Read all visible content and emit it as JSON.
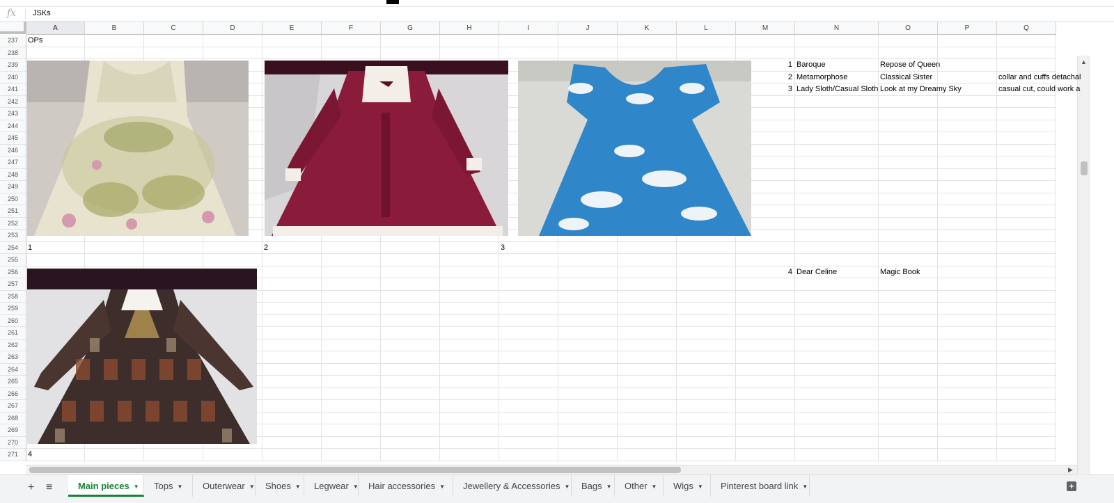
{
  "formula_bar": {
    "fx_icon": "fx-icon",
    "value": "JSKs"
  },
  "columns": [
    "A",
    "B",
    "C",
    "D",
    "E",
    "F",
    "G",
    "H",
    "I",
    "J",
    "K",
    "L",
    "M",
    "N",
    "O",
    "P",
    "Q"
  ],
  "selected_column": "A",
  "rows": [
    "237",
    "238",
    "239",
    "240",
    "241",
    "242",
    "243",
    "244",
    "245",
    "246",
    "247",
    "248",
    "249",
    "250",
    "251",
    "252",
    "253",
    "254",
    "255",
    "256",
    "257",
    "258",
    "259",
    "260",
    "261",
    "262",
    "263",
    "264",
    "265",
    "266",
    "267",
    "268",
    "269",
    "270",
    "271"
  ],
  "cells": {
    "A237": "OPs",
    "M239": "1",
    "N239": "Baroque",
    "O239": "Repose of Queen",
    "M240": "2",
    "N240": "Metamorphose",
    "O240": "Classical Sister",
    "Q240": "collar and cuffs detachal",
    "M241": "3",
    "N241": "Lady Sloth/Casual Sloth",
    "O241": "Look at my Dreamy Sky",
    "Q241": "casual cut, could work a",
    "A254": "1",
    "E254": "2",
    "I254": "3",
    "M256": "4",
    "N256": "Dear Celine",
    "O256": "Magic Book",
    "A271": "4"
  },
  "images": [
    {
      "id": "dress-1",
      "desc": "floral-green-dress"
    },
    {
      "id": "dress-2",
      "desc": "burgundy-dress"
    },
    {
      "id": "dress-3",
      "desc": "sky-blue-dress"
    },
    {
      "id": "dress-4",
      "desc": "book-print-dress"
    }
  ],
  "tabbar": {
    "add_icon": "plus-icon",
    "list_icon": "list-icon",
    "tabs": [
      {
        "label": "Main pieces",
        "active": true
      },
      {
        "label": "Tops"
      },
      {
        "label": "Outerwear"
      },
      {
        "label": "Shoes"
      },
      {
        "label": "Legwear"
      },
      {
        "label": "Hair accessories"
      },
      {
        "label": "Jewellery & Accessories"
      },
      {
        "label": "Bags"
      },
      {
        "label": "Other"
      },
      {
        "label": "Wigs"
      },
      {
        "label": "Pinterest board link"
      }
    ],
    "explore_icon": "explore-icon"
  },
  "colors": {
    "active_tab": "#188038",
    "grid_line": "#e2e3e3",
    "header_bg": "#f8f9fa"
  }
}
